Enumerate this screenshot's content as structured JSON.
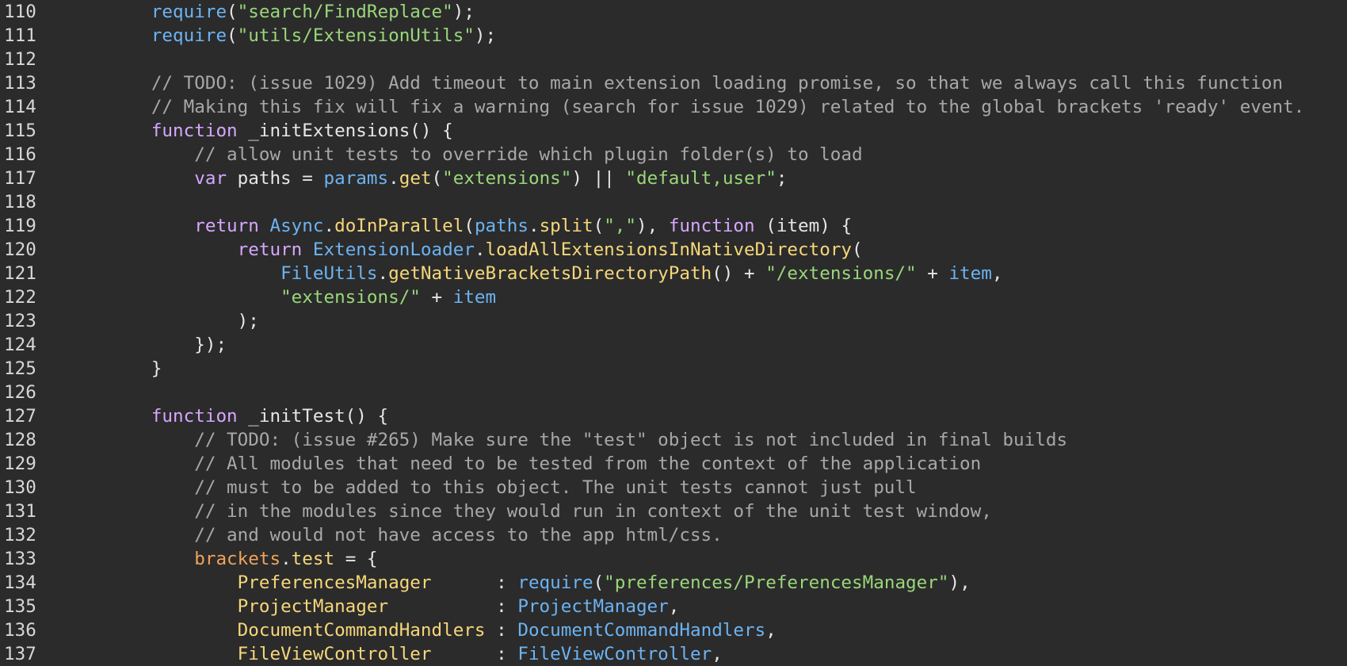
{
  "editor": {
    "lines": [
      {
        "number": "110",
        "tokens": [
          {
            "text": "        "
          },
          {
            "text": "require",
            "type": "builtin"
          },
          {
            "text": "("
          },
          {
            "text": "\"search/FindReplace\"",
            "type": "string"
          },
          {
            "text": ");"
          }
        ]
      },
      {
        "number": "111",
        "tokens": [
          {
            "text": "        "
          },
          {
            "text": "require",
            "type": "builtin"
          },
          {
            "text": "("
          },
          {
            "text": "\"utils/ExtensionUtils\"",
            "type": "string"
          },
          {
            "text": ");"
          }
        ]
      },
      {
        "number": "112",
        "tokens": [
          {
            "text": ""
          }
        ]
      },
      {
        "number": "113",
        "tokens": [
          {
            "text": "        "
          },
          {
            "text": "// TODO: (issue 1029) Add timeout to main extension loading promise, so that we always call this function",
            "type": "comment"
          }
        ]
      },
      {
        "number": "114",
        "tokens": [
          {
            "text": "        "
          },
          {
            "text": "// Making this fix will fix a warning (search for issue 1029) related to the global brackets 'ready' event.",
            "type": "comment"
          }
        ]
      },
      {
        "number": "115",
        "tokens": [
          {
            "text": "        "
          },
          {
            "text": "function",
            "type": "keyword"
          },
          {
            "text": " _initExtensions() {"
          }
        ]
      },
      {
        "number": "116",
        "tokens": [
          {
            "text": "            "
          },
          {
            "text": "// allow unit tests to override which plugin folder(s) to load",
            "type": "comment"
          }
        ]
      },
      {
        "number": "117",
        "tokens": [
          {
            "text": "            "
          },
          {
            "text": "var",
            "type": "keyword"
          },
          {
            "text": " paths = "
          },
          {
            "text": "params",
            "type": "builtin"
          },
          {
            "text": "."
          },
          {
            "text": "get",
            "type": "property"
          },
          {
            "text": "("
          },
          {
            "text": "\"extensions\"",
            "type": "string"
          },
          {
            "text": ") || "
          },
          {
            "text": "\"default,user\"",
            "type": "string"
          },
          {
            "text": ";"
          }
        ]
      },
      {
        "number": "118",
        "tokens": [
          {
            "text": ""
          }
        ]
      },
      {
        "number": "119",
        "tokens": [
          {
            "text": "            "
          },
          {
            "text": "return",
            "type": "keyword"
          },
          {
            "text": " "
          },
          {
            "text": "Async",
            "type": "builtin"
          },
          {
            "text": "."
          },
          {
            "text": "doInParallel",
            "type": "property"
          },
          {
            "text": "("
          },
          {
            "text": "paths",
            "type": "builtin"
          },
          {
            "text": "."
          },
          {
            "text": "split",
            "type": "property"
          },
          {
            "text": "("
          },
          {
            "text": "\",\"",
            "type": "string"
          },
          {
            "text": "), "
          },
          {
            "text": "function",
            "type": "keyword"
          },
          {
            "text": " (item) {"
          }
        ]
      },
      {
        "number": "120",
        "tokens": [
          {
            "text": "                "
          },
          {
            "text": "return",
            "type": "keyword"
          },
          {
            "text": " "
          },
          {
            "text": "ExtensionLoader",
            "type": "builtin"
          },
          {
            "text": "."
          },
          {
            "text": "loadAllExtensionsInNativeDirectory",
            "type": "property"
          },
          {
            "text": "("
          }
        ]
      },
      {
        "number": "121",
        "tokens": [
          {
            "text": "                    "
          },
          {
            "text": "FileUtils",
            "type": "builtin"
          },
          {
            "text": "."
          },
          {
            "text": "getNativeBracketsDirectoryPath",
            "type": "property"
          },
          {
            "text": "() + "
          },
          {
            "text": "\"/extensions/\"",
            "type": "string"
          },
          {
            "text": " + "
          },
          {
            "text": "item",
            "type": "builtin"
          },
          {
            "text": ","
          }
        ]
      },
      {
        "number": "122",
        "tokens": [
          {
            "text": "                    "
          },
          {
            "text": "\"extensions/\"",
            "type": "string"
          },
          {
            "text": " + "
          },
          {
            "text": "item",
            "type": "builtin"
          }
        ]
      },
      {
        "number": "123",
        "tokens": [
          {
            "text": "                "
          },
          {
            "text": ");"
          }
        ]
      },
      {
        "number": "124",
        "tokens": [
          {
            "text": "            "
          },
          {
            "text": "});"
          }
        ]
      },
      {
        "number": "125",
        "tokens": [
          {
            "text": "        "
          },
          {
            "text": "}"
          }
        ]
      },
      {
        "number": "126",
        "tokens": [
          {
            "text": ""
          }
        ]
      },
      {
        "number": "127",
        "tokens": [
          {
            "text": "        "
          },
          {
            "text": "function",
            "type": "keyword"
          },
          {
            "text": " _initTest() {"
          }
        ]
      },
      {
        "number": "128",
        "tokens": [
          {
            "text": "            "
          },
          {
            "text": "// TODO: (issue #265) Make sure the \"test\" object is not included in final builds",
            "type": "comment"
          }
        ]
      },
      {
        "number": "129",
        "tokens": [
          {
            "text": "            "
          },
          {
            "text": "// All modules that need to be tested from the context of the application",
            "type": "comment"
          }
        ]
      },
      {
        "number": "130",
        "tokens": [
          {
            "text": "            "
          },
          {
            "text": "// must to be added to this object. The unit tests cannot just pull",
            "type": "comment"
          }
        ]
      },
      {
        "number": "131",
        "tokens": [
          {
            "text": "            "
          },
          {
            "text": "// in the modules since they would run in context of the unit test window,",
            "type": "comment"
          }
        ]
      },
      {
        "number": "132",
        "tokens": [
          {
            "text": "            "
          },
          {
            "text": "// and would not have access to the app html/css.",
            "type": "comment"
          }
        ]
      },
      {
        "number": "133",
        "tokens": [
          {
            "text": "            "
          },
          {
            "text": "brackets",
            "type": "variable"
          },
          {
            "text": "."
          },
          {
            "text": "test",
            "type": "property"
          },
          {
            "text": " = {"
          }
        ]
      },
      {
        "number": "134",
        "tokens": [
          {
            "text": "                "
          },
          {
            "text": "PreferencesManager",
            "type": "property"
          },
          {
            "text": "      : "
          },
          {
            "text": "require",
            "type": "builtin"
          },
          {
            "text": "("
          },
          {
            "text": "\"preferences/PreferencesManager\"",
            "type": "string"
          },
          {
            "text": "),"
          }
        ]
      },
      {
        "number": "135",
        "tokens": [
          {
            "text": "                "
          },
          {
            "text": "ProjectManager",
            "type": "property"
          },
          {
            "text": "          : "
          },
          {
            "text": "ProjectManager",
            "type": "builtin"
          },
          {
            "text": ","
          }
        ]
      },
      {
        "number": "136",
        "tokens": [
          {
            "text": "                "
          },
          {
            "text": "DocumentCommandHandlers",
            "type": "property"
          },
          {
            "text": " : "
          },
          {
            "text": "DocumentCommandHandlers",
            "type": "builtin"
          },
          {
            "text": ","
          }
        ]
      },
      {
        "number": "137",
        "tokens": [
          {
            "text": "                "
          },
          {
            "text": "FileViewController",
            "type": "property"
          },
          {
            "text": "      : "
          },
          {
            "text": "FileViewController",
            "type": "builtin"
          },
          {
            "text": ","
          }
        ]
      }
    ]
  },
  "theme": {
    "background": "#2b2b2b",
    "plain": "#e6e6e6",
    "keyword": "#d6a7ff",
    "builtin": "#6db3f2",
    "string": "#99d77a",
    "comment": "#a8a8a8",
    "property": "#f6d77a",
    "variable": "#f0a35a",
    "line_number": "#d7d7d7"
  }
}
